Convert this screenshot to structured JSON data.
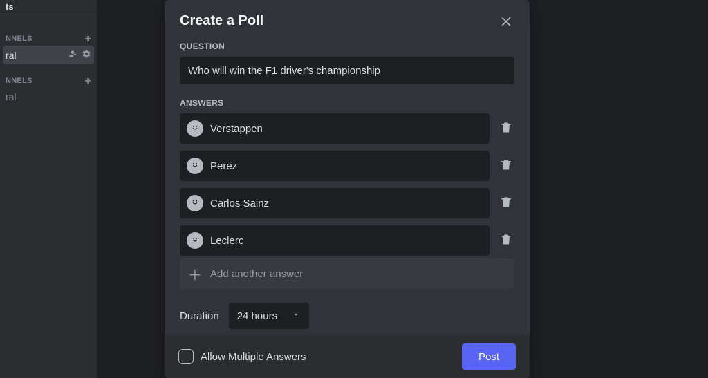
{
  "sidebar": {
    "header_text": "ts",
    "section_a_label": "NNELS",
    "channel_a": "ral",
    "section_b_label": "NNELS",
    "channel_b": "ral"
  },
  "modal": {
    "title": "Create a Poll",
    "question_label": "QUESTION",
    "question_value": "Who will win the F1 driver's championship",
    "answers_label": "ANSWERS",
    "answers": [
      {
        "value": "Verstappen"
      },
      {
        "value": "Perez"
      },
      {
        "value": "Carlos Sainz"
      },
      {
        "value": "Leclerc"
      }
    ],
    "add_answer_label": "Add another answer",
    "duration_label": "Duration",
    "duration_value": "24 hours",
    "allow_multiple_label": "Allow Multiple Answers",
    "post_label": "Post"
  }
}
